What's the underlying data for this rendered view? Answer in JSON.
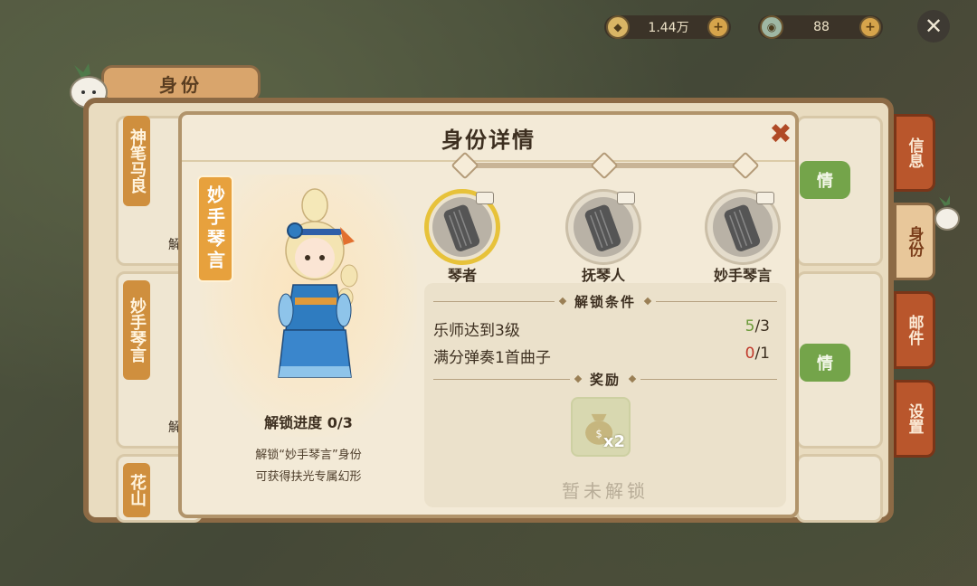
{
  "currency": {
    "coins": {
      "value": "1.44万",
      "icon": "coin-icon"
    },
    "gems": {
      "value": "88",
      "icon": "jade-coin-icon"
    },
    "plus": "+"
  },
  "close_glyph": "✕",
  "panel": {
    "tab_title": "身份",
    "cards": [
      {
        "name": "神笔马良",
        "button": "情",
        "partial": "解"
      },
      {
        "name": "妙手琴言",
        "button": "情",
        "partial": "解"
      },
      {
        "name": "花山"
      }
    ],
    "side_tabs": [
      "信息",
      "身份",
      "邮件",
      "设置"
    ]
  },
  "dialog": {
    "title": "身份详情",
    "close": "✖",
    "character_name": "妙手琴言",
    "progress_label": "解锁进度 0/3",
    "description_line1": "解锁“妙手琴言”身份",
    "description_line2": "可获得扶光专属幻形",
    "tiers": [
      {
        "label": "琴者",
        "active": true
      },
      {
        "label": "抚琴人",
        "active": false
      },
      {
        "label": "妙手琴言",
        "active": false
      }
    ],
    "unlock_conditions_title": "解锁条件",
    "conditions": [
      {
        "text": "乐师达到3级",
        "have": "5",
        "need": "/3",
        "met": true
      },
      {
        "text": "满分弹奏1首曲子",
        "have": "0",
        "need": "/1",
        "met": false
      }
    ],
    "reward_title": "奖励",
    "reward": {
      "icon": "money-bag-icon",
      "qty": "x2"
    },
    "locked_text": "暂未解锁"
  }
}
